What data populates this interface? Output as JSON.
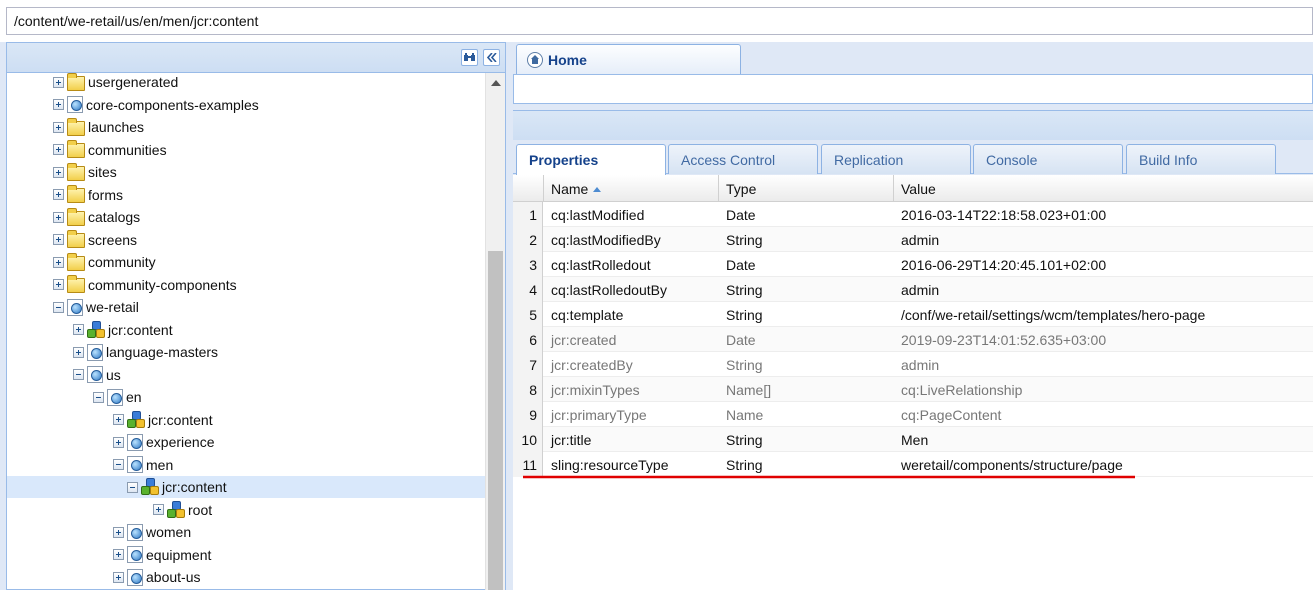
{
  "address": {
    "path": "/content/we-retail/us/en/men/jcr:content"
  },
  "tree": {
    "nodes": [
      {
        "label": "usergenerated",
        "icon": "folder",
        "expander": "plus"
      },
      {
        "label": "core-components-examples",
        "icon": "page",
        "expander": "plus"
      },
      {
        "label": "launches",
        "icon": "folder",
        "expander": "plus"
      },
      {
        "label": "communities",
        "icon": "folder",
        "expander": "plus"
      },
      {
        "label": "sites",
        "icon": "folder",
        "expander": "plus"
      },
      {
        "label": "forms",
        "icon": "folder",
        "expander": "plus"
      },
      {
        "label": "catalogs",
        "icon": "folder",
        "expander": "plus"
      },
      {
        "label": "screens",
        "icon": "folder",
        "expander": "plus"
      },
      {
        "label": "community",
        "icon": "folder",
        "expander": "plus"
      },
      {
        "label": "community-components",
        "icon": "folder",
        "expander": "plus"
      },
      {
        "label": "we-retail",
        "icon": "page",
        "expander": "minus"
      },
      {
        "label": "jcr:content",
        "icon": "component",
        "expander": "plus"
      },
      {
        "label": "language-masters",
        "icon": "page",
        "expander": "plus"
      },
      {
        "label": "us",
        "icon": "page",
        "expander": "minus"
      },
      {
        "label": "en",
        "icon": "page",
        "expander": "minus"
      },
      {
        "label": "jcr:content",
        "icon": "component",
        "expander": "plus"
      },
      {
        "label": "experience",
        "icon": "page",
        "expander": "plus"
      },
      {
        "label": "men",
        "icon": "page",
        "expander": "minus"
      },
      {
        "label": "jcr:content",
        "icon": "component",
        "expander": "minus",
        "selected": true
      },
      {
        "label": "root",
        "icon": "component",
        "expander": "plus"
      },
      {
        "label": "women",
        "icon": "page",
        "expander": "plus"
      },
      {
        "label": "equipment",
        "icon": "page",
        "expander": "plus"
      },
      {
        "label": "about-us",
        "icon": "page",
        "expander": "plus"
      }
    ]
  },
  "home_tab": {
    "label": "Home"
  },
  "tabs": [
    {
      "label": "Properties",
      "active": true
    },
    {
      "label": "Access Control"
    },
    {
      "label": "Replication"
    },
    {
      "label": "Console"
    },
    {
      "label": "Build Info"
    }
  ],
  "grid": {
    "columns": {
      "name": "Name",
      "type": "Type",
      "value": "Value"
    },
    "rows": [
      {
        "num": "1",
        "name": "cq:lastModified",
        "type": "Date",
        "value": "2016-03-14T22:18:58.023+01:00"
      },
      {
        "num": "2",
        "name": "cq:lastModifiedBy",
        "type": "String",
        "value": "admin"
      },
      {
        "num": "3",
        "name": "cq:lastRolledout",
        "type": "Date",
        "value": "2016-06-29T14:20:45.101+02:00"
      },
      {
        "num": "4",
        "name": "cq:lastRolledoutBy",
        "type": "String",
        "value": "admin"
      },
      {
        "num": "5",
        "name": "cq:template",
        "type": "String",
        "value": "/conf/we-retail/settings/wcm/templates/hero-page"
      },
      {
        "num": "6",
        "name": "jcr:created",
        "type": "Date",
        "value": "2019-09-23T14:01:52.635+03:00",
        "protected": true
      },
      {
        "num": "7",
        "name": "jcr:createdBy",
        "type": "String",
        "value": "admin",
        "protected": true
      },
      {
        "num": "8",
        "name": "jcr:mixinTypes",
        "type": "Name[]",
        "value": "cq:LiveRelationship",
        "protected": true
      },
      {
        "num": "9",
        "name": "jcr:primaryType",
        "type": "Name",
        "value": "cq:PageContent",
        "protected": true
      },
      {
        "num": "10",
        "name": "jcr:title",
        "type": "String",
        "value": "Men"
      },
      {
        "num": "11",
        "name": "sling:resourceType",
        "type": "String",
        "value": "weretail/components/structure/page"
      }
    ]
  },
  "colors": {
    "accent": "#15428b",
    "panel_border": "#99bbe8",
    "selection": "#d9e8fb",
    "annotation": "#e00000"
  }
}
